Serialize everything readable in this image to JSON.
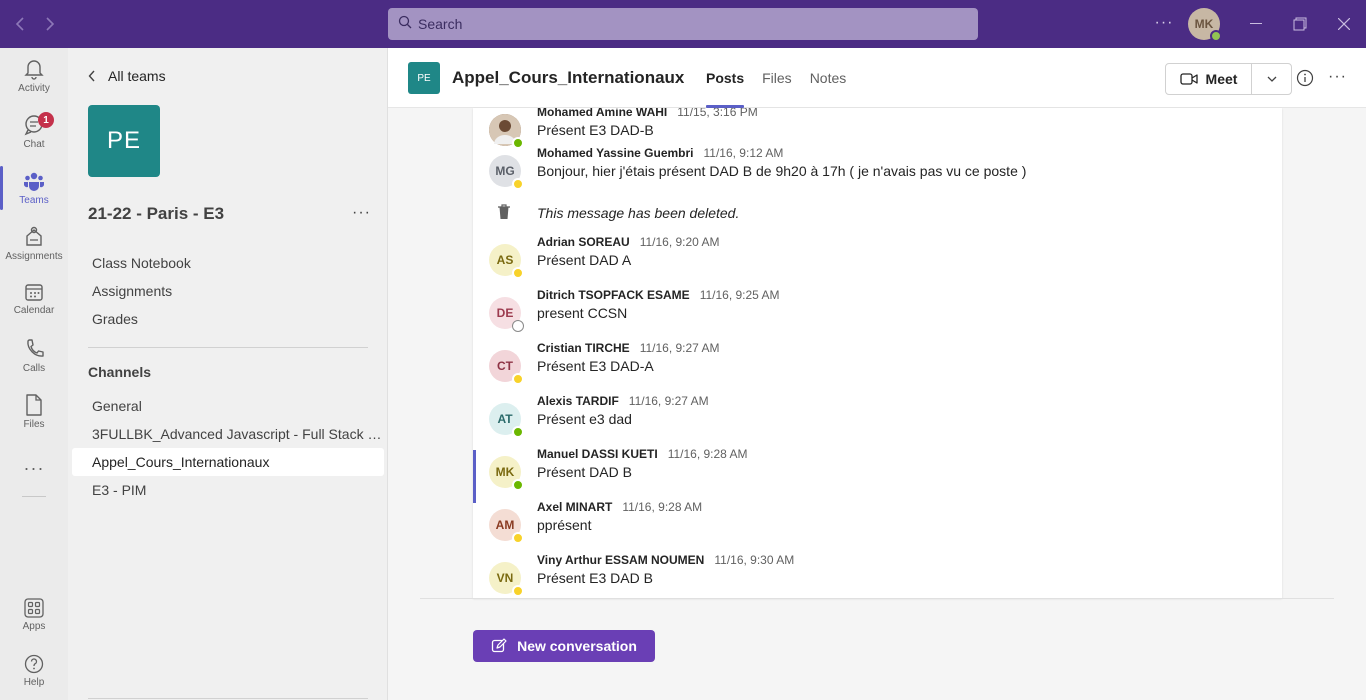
{
  "search": {
    "placeholder": "Search"
  },
  "user": {
    "initials": "MK"
  },
  "appbar": {
    "items": [
      {
        "label": "Activity",
        "icon": "bell-icon"
      },
      {
        "label": "Chat",
        "icon": "chat-icon",
        "badge": "1"
      },
      {
        "label": "Teams",
        "icon": "teams-icon"
      },
      {
        "label": "Assignments",
        "icon": "assignments-icon"
      },
      {
        "label": "Calendar",
        "icon": "calendar-icon"
      },
      {
        "label": "Calls",
        "icon": "phone-icon"
      },
      {
        "label": "Files",
        "icon": "file-icon"
      },
      {
        "label": "Apps",
        "icon": "apps-icon"
      },
      {
        "label": "Help",
        "icon": "help-icon"
      }
    ]
  },
  "team": {
    "back_label": "All teams",
    "tile_initials": "PE",
    "name": "21-22 - Paris - E3",
    "links": [
      "Class Notebook",
      "Assignments",
      "Grades"
    ],
    "channels_heading": "Channels",
    "channels": [
      "General",
      "3FULLBK_Advanced Javascript - Full Stack D...",
      "Appel_Cours_Internationaux",
      "E3 - PIM"
    ]
  },
  "channel": {
    "icon_initials": "PE",
    "title": "Appel_Cours_Internationaux",
    "tabs": [
      "Posts",
      "Files",
      "Notes"
    ],
    "meet_label": "Meet"
  },
  "messages": [
    {
      "initials": "",
      "author": "Mohamed Amine WAHI",
      "time": "11/15, 3:16 PM",
      "text": "Présent E3 DAD-B",
      "status": "available"
    },
    {
      "initials": "MG",
      "author": "Mohamed Yassine Guembri",
      "time": "11/16, 9:12 AM",
      "text": "Bonjour, hier j'étais présent DAD B de 9h20 à 17h ( je n'avais pas vu ce poste )",
      "status": "away"
    },
    {
      "deleted": true,
      "text": "This message has been deleted."
    },
    {
      "initials": "AS",
      "author": "Adrian SOREAU",
      "time": "11/16, 9:20 AM",
      "text": "Présent DAD A",
      "status": "away"
    },
    {
      "initials": "DE",
      "author": "Ditrich TSOPFACK ESAME",
      "time": "11/16, 9:25 AM",
      "text": "present CCSN",
      "status": "offline"
    },
    {
      "initials": "CT",
      "author": "Cristian TIRCHE",
      "time": "11/16, 9:27 AM",
      "text": "Présent E3 DAD-A",
      "status": "away"
    },
    {
      "initials": "AT",
      "author": "Alexis TARDIF",
      "time": "11/16, 9:27 AM",
      "text": "Présent e3 dad",
      "status": "available"
    },
    {
      "initials": "MK",
      "author": "Manuel DASSI KUETI",
      "time": "11/16, 9:28 AM",
      "text": "Présent DAD B",
      "status": "available"
    },
    {
      "initials": "AM",
      "author": "Axel MINART",
      "time": "11/16, 9:28 AM",
      "text": "pprésent",
      "status": "away"
    },
    {
      "initials": "VN",
      "author": "Viny Arthur ESSAM NOUMEN",
      "time": "11/16, 9:30 AM",
      "text": "Présent E3 DAD B",
      "status": "away"
    }
  ],
  "new_conversation_label": "New conversation",
  "colors": {
    "titlebar": "#4b2c84",
    "accent": "#5b5fc7",
    "team_tile": "#1f8787"
  }
}
